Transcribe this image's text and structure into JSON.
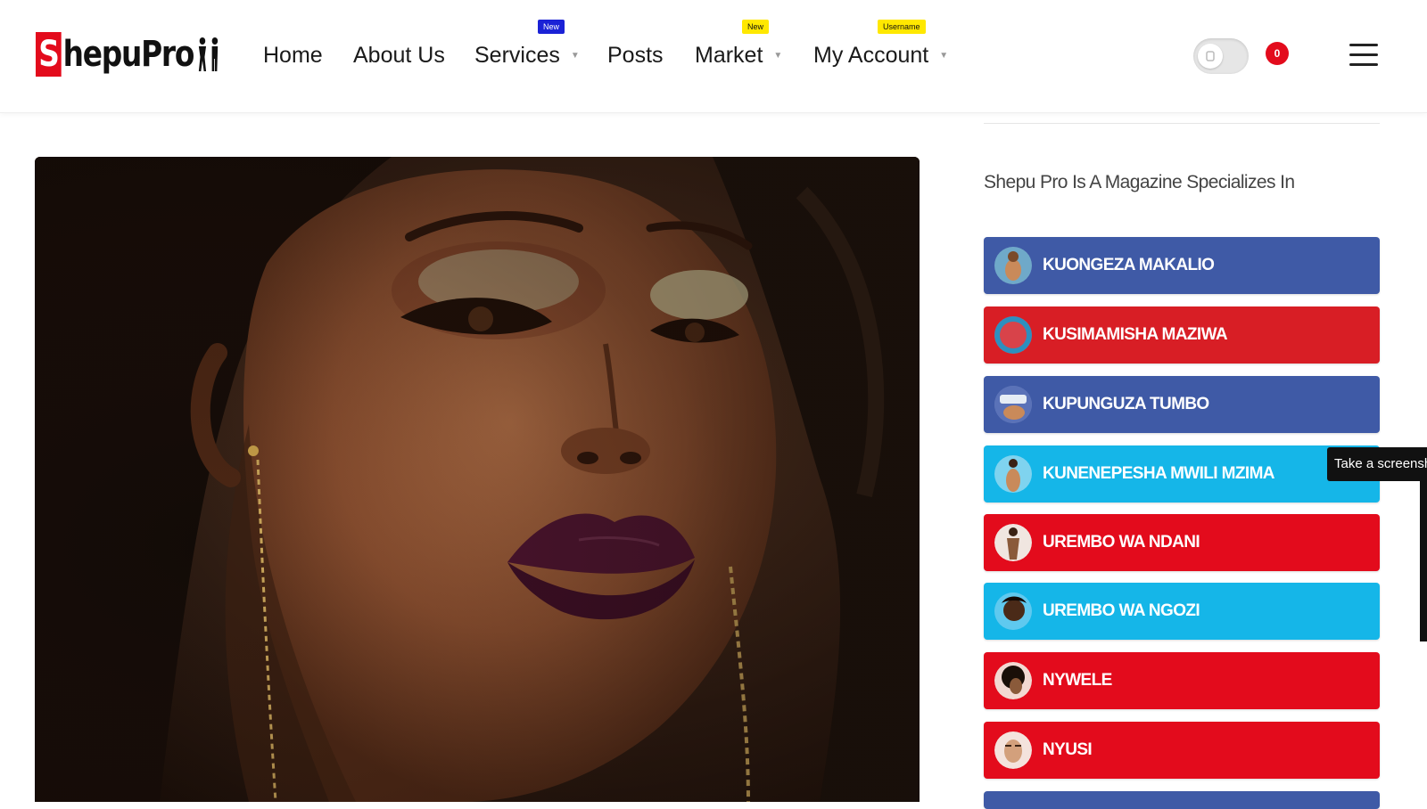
{
  "brand": {
    "logo_letter": "S",
    "logo_rest": "hepuPro",
    "accent": "#e30b1c"
  },
  "nav": {
    "home": "Home",
    "about": "About Us",
    "services": "Services",
    "services_badge": "New",
    "posts": "Posts",
    "market": "Market",
    "market_badge": "New",
    "account": "My Account",
    "account_badge": "Username"
  },
  "header_controls": {
    "theme_toggle_state": "off",
    "notification_count": "0",
    "menu_icon": "hamburger-icon"
  },
  "sidebar": {
    "heading": "Shepu Pro Is A Magazine Specializes In",
    "categories": [
      {
        "label": "KUONGEZA MAKALIO",
        "color": "#3f5aa6"
      },
      {
        "label": "KUSIMAMISHA MAZIWA",
        "color": "#d81e25"
      },
      {
        "label": "KUPUNGUZA TUMBO",
        "color": "#3f5aa6"
      },
      {
        "label": "KUNENEPESHA MWILI MZIMA",
        "color": "#15b6e8"
      },
      {
        "label": "UREMBO WA NDANI",
        "color": "#e30b1c"
      },
      {
        "label": "UREMBO WA NGOZI",
        "color": "#15b6e8"
      },
      {
        "label": "NYWELE",
        "color": "#e30b1c"
      },
      {
        "label": "NYUSI",
        "color": "#e30b1c"
      }
    ]
  },
  "tooltip": {
    "text": "Take a screensh"
  }
}
